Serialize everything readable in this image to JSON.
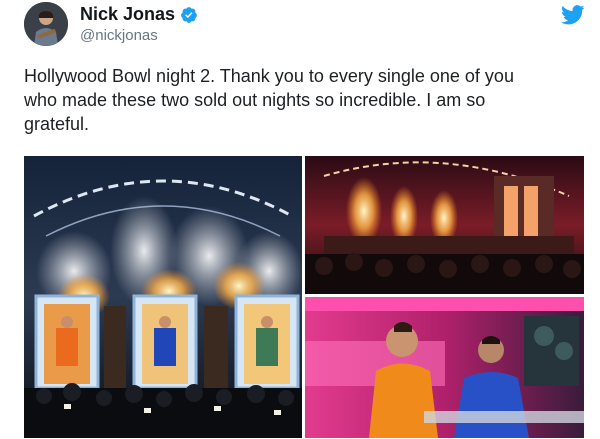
{
  "author": {
    "display_name": "Nick Jonas",
    "handle": "@nickjonas",
    "verified": true,
    "avatar_icon": "profile-photo"
  },
  "brand_icon": "twitter-bird-icon",
  "tweet": {
    "text": "Hollywood Bowl night 2. Thank you to every single one of you\nwho made these two sold out nights so incredible. I am so\ngrateful."
  },
  "colors": {
    "twitter_blue": "#1da1f2",
    "name": "#14171a",
    "handle": "#657786"
  },
  "media": [
    {
      "description": "stage-with-three-glowing-doors"
    },
    {
      "description": "crowd-and-stage-fireworks"
    },
    {
      "description": "performers-on-pink-stage"
    }
  ]
}
